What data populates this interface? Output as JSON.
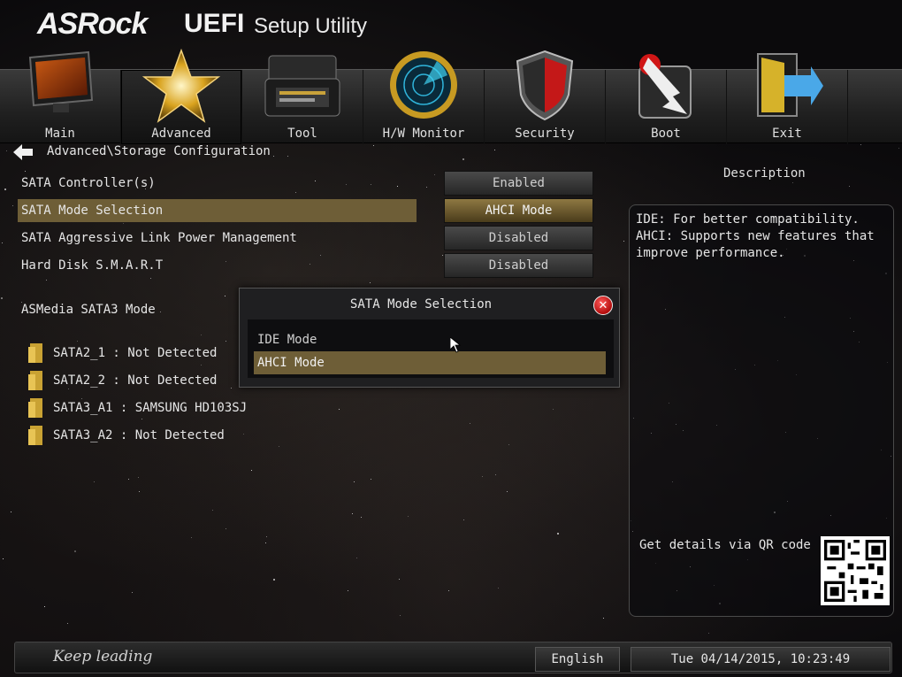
{
  "header": {
    "brand": "ASRock",
    "product": "UEFI",
    "subtitle": "Setup Utility"
  },
  "tabs": [
    {
      "label": "Main",
      "icon": "monitor-icon"
    },
    {
      "label": "Advanced",
      "icon": "star-icon",
      "active": true
    },
    {
      "label": "Tool",
      "icon": "toolbox-icon"
    },
    {
      "label": "H/W Monitor",
      "icon": "radar-icon"
    },
    {
      "label": "Security",
      "icon": "shield-icon"
    },
    {
      "label": "Boot",
      "icon": "boot-arrow-icon"
    },
    {
      "label": "Exit",
      "icon": "exit-door-icon"
    }
  ],
  "breadcrumb": "Advanced\\Storage Configuration",
  "settings": [
    {
      "label": "SATA Controller(s)",
      "value": "Enabled"
    },
    {
      "label": "SATA Mode Selection",
      "value": "AHCI Mode",
      "selected": true
    },
    {
      "label": "SATA Aggressive Link Power Management",
      "value": "Disabled"
    },
    {
      "label": "Hard Disk S.M.A.R.T",
      "value": "Disabled"
    }
  ],
  "asmedia_label": "ASMedia SATA3 Mode",
  "drives": [
    "SATA2_1 : Not Detected",
    "SATA2_2 : Not Detected",
    "SATA3_A1 : SAMSUNG HD103SJ",
    "SATA3_A2 : Not Detected"
  ],
  "description": {
    "title": "Description",
    "text": "IDE: For better compatibility. AHCI: Supports new features that improve performance.",
    "qr_label": "Get details via QR code"
  },
  "dialog": {
    "title": "SATA Mode Selection",
    "options": [
      "IDE Mode",
      "AHCI Mode"
    ],
    "selected_index": 1
  },
  "footer": {
    "slogan": "Keep leading",
    "language": "English",
    "datetime": "Tue 04/14/2015, 10:23:49"
  },
  "colors": {
    "accent_highlight": "#6e5e37",
    "close_red": "#d01616"
  }
}
